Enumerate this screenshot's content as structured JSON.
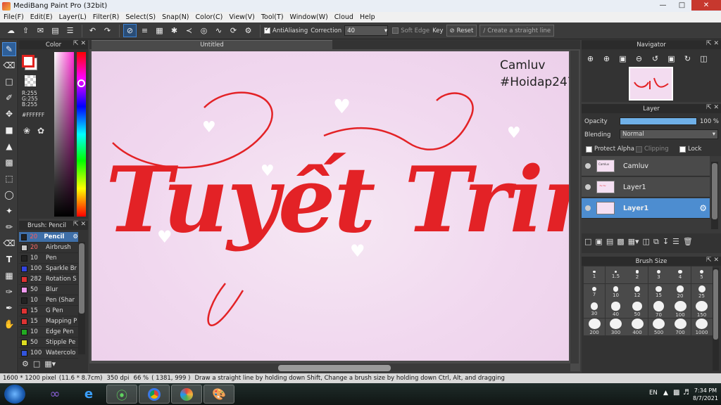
{
  "window": {
    "title": "MediBang Paint Pro (32bit)"
  },
  "menu": [
    "File(F)",
    "Edit(E)",
    "Layer(L)",
    "Filter(R)",
    "Select(S)",
    "Snap(N)",
    "Color(C)",
    "View(V)",
    "Tool(T)",
    "Window(W)",
    "Cloud",
    "Help"
  ],
  "toolbar": {
    "antialiasing_label": "AntiAliasing",
    "correction_label": "Correction",
    "correction_value": "40",
    "soft_edge_label": "Soft Edge",
    "key_label": "Key",
    "reset_label": "Reset",
    "straight_line_label": "Create a straight line"
  },
  "color_panel": {
    "title": "Color",
    "r": "R:255",
    "g": "G:255",
    "b": "B:255",
    "hex": "#FFFFFF",
    "foreground": "#e0221e",
    "background": "#ffffff"
  },
  "brush_panel": {
    "title": "Brush: Pencil",
    "brushes": [
      {
        "size": "20",
        "name": "Pencil",
        "color": "#222222",
        "selected": true
      },
      {
        "size": "20",
        "name": "Airbrush",
        "color": "#c8c8c8"
      },
      {
        "size": "10",
        "name": "Pen",
        "color": "#222222"
      },
      {
        "size": "100",
        "name": "Sparkle Br",
        "color": "#3344dd"
      },
      {
        "size": "282",
        "name": "Rotation S",
        "color": "#dd3333"
      },
      {
        "size": "50",
        "name": "Blur",
        "color": "#ee99ee"
      },
      {
        "size": "10",
        "name": "Pen (Shar",
        "color": "#222222"
      },
      {
        "size": "15",
        "name": "G Pen",
        "color": "#dd3333"
      },
      {
        "size": "15",
        "name": "Mapping P",
        "color": "#dd3333"
      },
      {
        "size": "10",
        "name": "Edge Pen",
        "color": "#22aa22"
      },
      {
        "size": "50",
        "name": "Stipple Pe",
        "color": "#dddd22"
      },
      {
        "size": "100",
        "name": "Watercolo",
        "color": "#3355dd"
      }
    ]
  },
  "canvas": {
    "tab_title": "Untitled",
    "artwork_text": "Tuyết Trinh",
    "watermark_line1": "Camluv",
    "watermark_line2": "#Hoidap247"
  },
  "navigator": {
    "title": "Navigator"
  },
  "layer_panel": {
    "title": "Layer",
    "opacity_label": "Opacity",
    "opacity_value": "100 %",
    "opacity_fraction": 1.0,
    "blending_label": "Blending",
    "blending_value": "Normal",
    "protect_alpha_label": "Protect Alpha",
    "clipping_label": "Clipping",
    "lock_label": "Lock",
    "layers": [
      {
        "name": "Camluv"
      },
      {
        "name": "Layer1"
      },
      {
        "name": "Layer1",
        "selected": true
      }
    ]
  },
  "brush_size_panel": {
    "title": "Brush Size",
    "sizes": [
      "1",
      "1.5",
      "2",
      "3",
      "4",
      "5",
      "7",
      "10",
      "12",
      "15",
      "20",
      "25",
      "30",
      "40",
      "50",
      "70",
      "100",
      "150",
      "200",
      "300",
      "400",
      "500",
      "700",
      "1000"
    ]
  },
  "status_bar": {
    "dimensions": "1600 * 1200 pixel",
    "physical": "(11.6 * 8.7cm)",
    "dpi": "350 dpi",
    "zoom": "66 %",
    "coords": "( 1381, 999 )",
    "hint": "Draw a straight line by holding down Shift, Change a brush size by holding down Ctrl, Alt, and dragging"
  },
  "taskbar": {
    "language": "EN",
    "time": "7:34 PM",
    "date": "8/7/2021"
  }
}
